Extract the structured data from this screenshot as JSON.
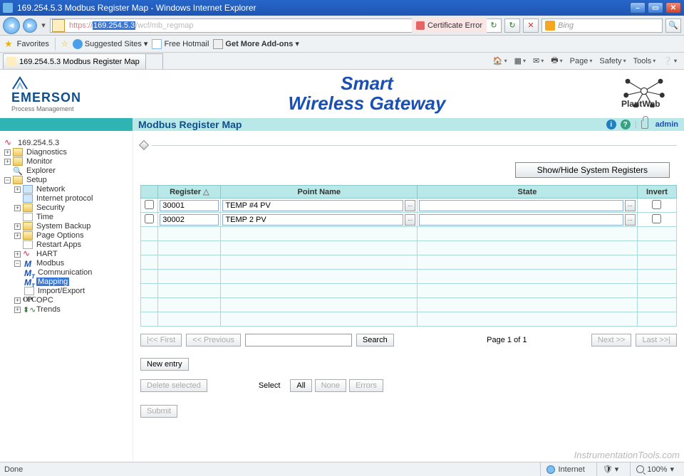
{
  "window": {
    "title": "169.254.5.3 Modbus Register Map - Windows Internet Explorer",
    "url_prefix": "https://",
    "url_host": "169.254.5.3",
    "url_path": "/wcf/mb_regmap",
    "cert_label": "Certificate Error",
    "search_placeholder": "Bing"
  },
  "toolbar": {
    "favorites": "Favorites",
    "suggested": "Suggested Sites",
    "hotmail": "Free Hotmail",
    "addons": "Get More Add-ons"
  },
  "tab": {
    "title": "169.254.5.3 Modbus Register Map"
  },
  "tabmenu": {
    "page": "Page",
    "safety": "Safety",
    "tools": "Tools"
  },
  "brand": {
    "emerson": "EMERSON",
    "emerson_sub": "Process Management",
    "title1": "Smart",
    "title2": "Wireless Gateway",
    "plantweb": "PlantWeb"
  },
  "stripe": {
    "title": "Modbus Register Map",
    "admin": "admin"
  },
  "tree": {
    "root": "169.254.5.3",
    "diag": "Diagnostics",
    "monitor": "Monitor",
    "explorer": "Explorer",
    "setup": "Setup",
    "network": "Network",
    "internet": "Internet protocol",
    "security": "Security",
    "time": "Time",
    "backup": "System Backup",
    "pageopt": "Page Options",
    "restart": "Restart Apps",
    "hart": "HART",
    "modbus": "Modbus",
    "comm": "Communication",
    "mapping": "Mapping",
    "import": "Import/Export",
    "opc": "OPC",
    "trends": "Trends"
  },
  "main": {
    "show_hide": "Show/Hide System Registers",
    "cols": {
      "register": "Register",
      "point": "Point Name",
      "state": "State",
      "invert": "Invert"
    },
    "rows": [
      {
        "register": "30001",
        "point": "TEMP #4 PV",
        "state": ""
      },
      {
        "register": "30002",
        "point": "TEMP 2 PV",
        "state": ""
      }
    ],
    "first": "|<< First",
    "prev": "<< Previous",
    "search": "Search",
    "page_of": "Page 1 of 1",
    "next": "Next >>",
    "last": "Last >>|",
    "new_entry": "New entry",
    "delete": "Delete selected",
    "select_lbl": "Select",
    "sel_all": "All",
    "sel_none": "None",
    "sel_err": "Errors",
    "submit": "Submit"
  },
  "watermark": "InstrumentationTools.com",
  "status": {
    "done": "Done",
    "zone": "Internet",
    "zoom": "100%"
  }
}
